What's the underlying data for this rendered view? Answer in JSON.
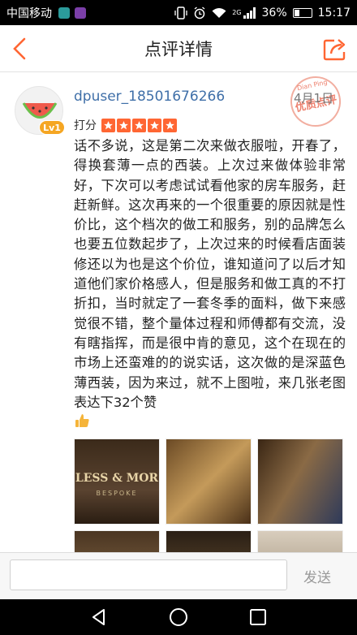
{
  "status_bar": {
    "carrier": "中国移动",
    "signal_badge": "2G",
    "battery_percent": "36%",
    "battery_level": 0.36,
    "time": "15:17"
  },
  "header": {
    "title": "点评详情",
    "back_icon": "chevron-left-icon",
    "share_icon": "share-icon"
  },
  "review": {
    "username": "dpuser_18501676266",
    "level": "Lv1",
    "date": "4月1日",
    "stamp_top": "Dian Ping",
    "stamp_text": "优质点评",
    "rating_label": "打分",
    "stars": 5,
    "text": "话不多说，这是第二次来做衣服啦，开春了，得换套薄一点的西装。上次过来做体验非常好，下次可以考虑试试看他家的房车服务，赶赶新鲜。这次再来的一个很重要的原因就是性价比，这个档次的做工和服务，别的品牌怎么也要五位数起步了，上次过来的时候看店面装修还以为也是这个价位，谁知道问了以后才知道他们家价格感人，但是服务和做工真的不打折扣，当时就定了一套冬季的面料，做下来感觉很不错，整个量体过程和师傅都有交流，没有瞎指挥，而是很中肯的意见，这个在现在的市场上还蛮难的的说实话，这次做的是深蓝色薄西装，因为来过，就不上图啦，来几张老图表达下32个赞",
    "emoji": "thumbs-up-icon",
    "photos": [
      {
        "name": "storefront-sign-photo",
        "sign": "LESS & MOR",
        "sub": "BESPOKE"
      },
      {
        "name": "shop-shelves-photo"
      },
      {
        "name": "suit-rack-photo"
      },
      {
        "name": "shop-interior-photo"
      },
      {
        "name": "display-wall-photo"
      },
      {
        "name": "fitting-area-photo"
      }
    ]
  },
  "footer": {
    "input_value": "",
    "input_placeholder": "",
    "send_label": "发送"
  },
  "colors": {
    "accent": "#ff6633",
    "username": "#3f6fa8",
    "level_badge": "#f5a623"
  }
}
